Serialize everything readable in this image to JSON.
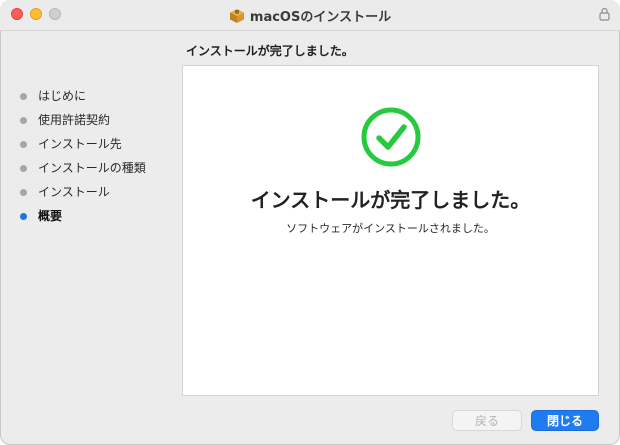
{
  "window": {
    "title": "macOSのインストール",
    "app_icon": "installer-box-icon",
    "lock_icon": "lock-icon"
  },
  "header": {
    "status_text": "インストールが完了しました。"
  },
  "sidebar": {
    "steps": [
      {
        "label": "はじめに",
        "state": "done"
      },
      {
        "label": "使用許諾契約",
        "state": "done"
      },
      {
        "label": "インストール先",
        "state": "done"
      },
      {
        "label": "インストールの種類",
        "state": "done"
      },
      {
        "label": "インストール",
        "state": "done"
      },
      {
        "label": "概要",
        "state": "active"
      }
    ],
    "active_color": "#1a73e8",
    "inactive_color": "#a6a6a6"
  },
  "main": {
    "icon": "checkmark-circle-icon",
    "icon_color": "#27c93f",
    "title": "インストールが完了しました。",
    "message": "ソフトウェアがインストールされました。"
  },
  "buttons": {
    "back_label": "戻る",
    "close_label": "閉じる",
    "accent": "#1f7cf0"
  }
}
